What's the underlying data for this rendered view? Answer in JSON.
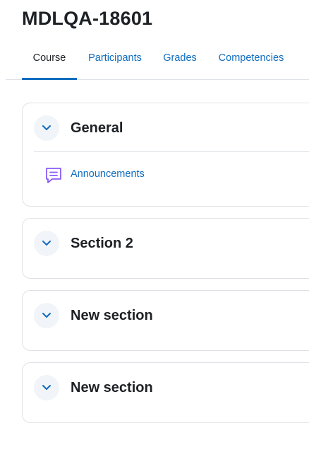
{
  "page": {
    "title": "MDLQA-18601"
  },
  "tabs": [
    {
      "label": "Course",
      "active": true
    },
    {
      "label": "Participants",
      "active": false
    },
    {
      "label": "Grades",
      "active": false
    },
    {
      "label": "Competencies",
      "active": false
    }
  ],
  "sections": [
    {
      "title": "General",
      "toggle_icon": "chevron-down-icon",
      "activities": [
        {
          "label": "Announcements",
          "icon": "forum-icon"
        }
      ]
    },
    {
      "title": "Section 2",
      "toggle_icon": "chevron-down-icon"
    },
    {
      "title": "New section",
      "toggle_icon": "chevron-down-icon"
    },
    {
      "title": "New section",
      "toggle_icon": "chevron-down-icon"
    }
  ],
  "colors": {
    "link": "#0f6cbf",
    "text": "#1d2125",
    "border": "#dee2e6",
    "toggle_bg": "#f1f4f8",
    "forum_icon": "#8a5cf5"
  }
}
